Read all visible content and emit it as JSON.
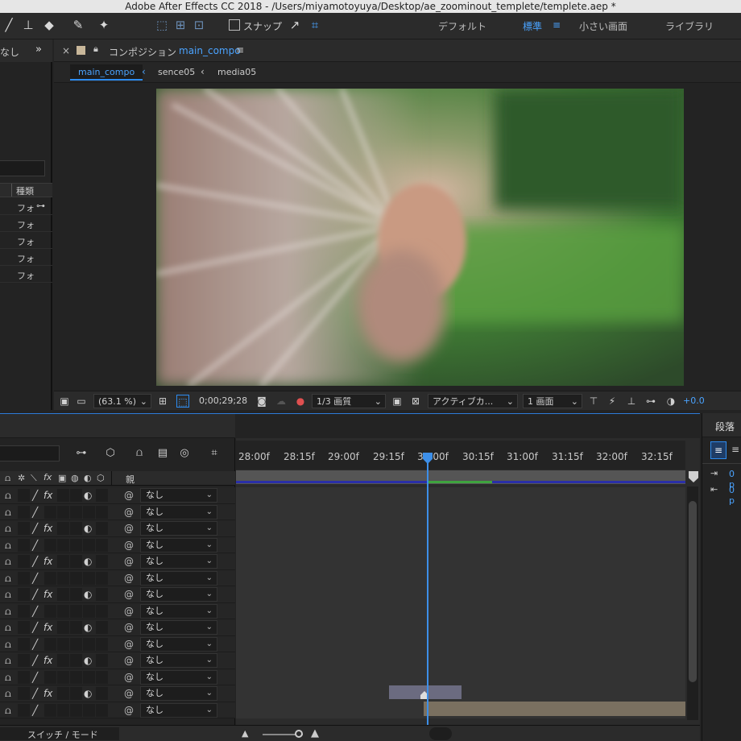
{
  "window_title": "Adobe After Effects CC 2018 - /Users/miyamotoyuya/Desktop/ae_zoominout_templete/templete.aep *",
  "toolbar": {
    "snap_label": "スナップ",
    "workspaces": [
      "デフォルト",
      "標準",
      "小さい画面",
      "ライブラリ"
    ],
    "active_workspace": "標準"
  },
  "project": {
    "panel_title_fragment": "なし",
    "column_type": "種類",
    "rows": [
      "フォ",
      "フォ",
      "フォ",
      "フォ",
      "フォ"
    ]
  },
  "comp": {
    "panel_label": "コンポジション",
    "comp_name": "main_compo",
    "breadcrumbs": [
      "main_compo",
      "sence05",
      "media05"
    ],
    "zoom": "(63.1 %)",
    "timecode": "0;00;29;28",
    "resolution": "1/3 画質",
    "camera": "アクティブカ...",
    "views": "1 画面",
    "exposure": "+0.0"
  },
  "timeline": {
    "ruler_ticks": [
      "28:00f",
      "28:15f",
      "29:00f",
      "29:15f",
      "30:00f",
      "30:15f",
      "31:00f",
      "31:15f",
      "32:00f",
      "32:15f"
    ],
    "parent_header": "親",
    "layers": [
      {
        "fx": true,
        "parent": "なし"
      },
      {
        "fx": false,
        "parent": "なし"
      },
      {
        "fx": true,
        "parent": "なし"
      },
      {
        "fx": false,
        "parent": "なし"
      },
      {
        "fx": true,
        "parent": "なし"
      },
      {
        "fx": false,
        "parent": "なし"
      },
      {
        "fx": true,
        "parent": "なし"
      },
      {
        "fx": false,
        "parent": "なし"
      },
      {
        "fx": true,
        "parent": "なし"
      },
      {
        "fx": false,
        "parent": "なし"
      },
      {
        "fx": true,
        "parent": "なし"
      },
      {
        "fx": false,
        "parent": "なし"
      },
      {
        "fx": true,
        "parent": "なし"
      },
      {
        "fx": false,
        "parent": "なし"
      }
    ],
    "bottom_toggle": "スイッチ / モード"
  },
  "paragraph": {
    "title": "段落",
    "indent_values": [
      "0 p",
      "0 p"
    ]
  },
  "colors": {
    "accent": "#2d8cf0",
    "playhead": "#3d8fe8",
    "clip_gray": "#6b6b80",
    "clip_tan": "#7a7060"
  }
}
